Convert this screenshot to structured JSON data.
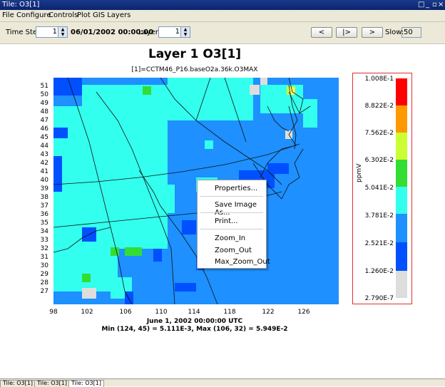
{
  "window": {
    "title": "Tile: O3[1]",
    "controls": [
      "□",
      "–",
      "▫",
      "×"
    ]
  },
  "menu": [
    "File",
    "Configure",
    "Controls",
    "Plot",
    "GIS Layers"
  ],
  "toolbar": {
    "time_step_label": "Time Step:",
    "time_step_value": "1",
    "datetime": "06/01/2002 00:00:00",
    "layer_label": "Layer:",
    "layer_value": "1",
    "prev": "<",
    "play": "|>",
    "next": ">",
    "slow_label": "Slow:",
    "slow_value": "50"
  },
  "plot": {
    "title": "Layer 1 O3[1]",
    "subtitle": "[1]=CCTM46_P16.baseO2a.36k.O3MAX",
    "y_ticks": [
      "51",
      "50",
      "49",
      "48",
      "47",
      "46",
      "45",
      "44",
      "43",
      "42",
      "41",
      "40",
      "39",
      "38",
      "37",
      "36",
      "35",
      "34",
      "33",
      "32",
      "31",
      "30",
      "29",
      "28",
      "27"
    ],
    "x_ticks": [
      "98",
      "102",
      "106",
      "110",
      "114",
      "118",
      "122",
      "126"
    ],
    "footer_date": "June 1, 2002 00:00:00 UTC",
    "footer_minmax": "Min (124, 45) = 5.111E-3, Max (106, 32) = 5.949E-2"
  },
  "legend": {
    "unit": "ppmV",
    "labels": [
      "1.008E-1",
      "8.822E-2",
      "7.562E-2",
      "6.302E-2",
      "5.041E-2",
      "3.781E-2",
      "2.521E-2",
      "1.260E-2",
      "2.790E-7"
    ],
    "colors": [
      "#ff0000",
      "#ff9900",
      "#ccff33",
      "#33dd33",
      "#33ffee",
      "#1e90ff",
      "#0050ff",
      "#dddddd"
    ]
  },
  "context_menu": [
    "Properties...",
    "Save Image As...",
    "Print...",
    "Zoom_In",
    "Zoom_Out",
    "Max_Zoom_Out"
  ],
  "tabs": [
    "Tile: O3[1]",
    "Tile: O3[1]",
    "Tile: O3[1]"
  ]
}
